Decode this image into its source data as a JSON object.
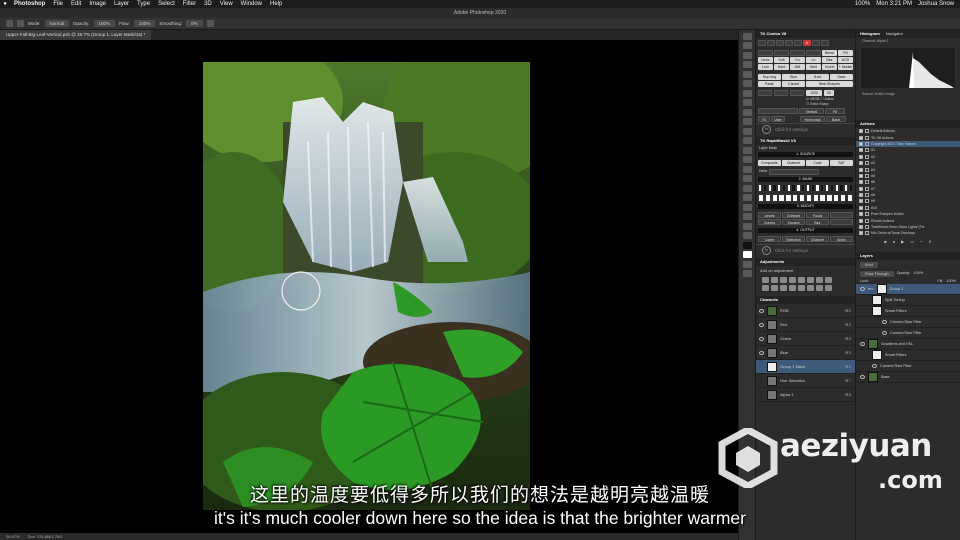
{
  "menubar": {
    "app": "Photoshop",
    "items": [
      "File",
      "Edit",
      "Image",
      "Layer",
      "Type",
      "Select",
      "Filter",
      "3D",
      "View",
      "Window",
      "Help"
    ],
    "battery": "100%",
    "clock": "Mon 3:21 PM",
    "user": "Joshua Snow"
  },
  "app_title": "Adobe Photoshop 2020",
  "options_bar": {
    "mode_label": "Mode:",
    "mode_value": "Normal",
    "opacity_label": "Opacity:",
    "opacity_value": "100%",
    "flow_label": "Flow:",
    "flow_value": "100%",
    "smoothing_label": "Smoothing:",
    "smoothing_value": "0%"
  },
  "document_tab": "Upper-Fall-Big-Leaf-Vertical.psb @ 26.7% (Group 1, Layer Mask/16) *",
  "statusbar": {
    "zoom": "26.67%",
    "doc": "Doc: 374.8M/1.76G"
  },
  "tk_panel": {
    "title": "TK Combo V8",
    "buttons_row1": [
      "Blend",
      "Fill"
    ],
    "buttons_row2": [
      "Norm",
      "Soft",
      "Co",
      "Lu",
      "Blur",
      "ACR"
    ],
    "buttons_row3": [
      "Lum",
      "Hard",
      "Diff",
      "Mult",
      "Invert",
      "+ Sketch"
    ],
    "buttons_row4": [
      "Dup Img",
      "Size",
      "8-bit",
      "Save"
    ],
    "buttons_row5": [
      "Paste",
      "Cancel",
      "Web Sharpen"
    ],
    "size_value": "1200",
    "size_value2": "30",
    "checkbox1": "sRGB",
    "checkbox2": "Action",
    "checkbox3": "Extra Sharp",
    "vertical": "Vertical",
    "fit": "Fit",
    "horizontal": "Horizontal",
    "base": "Base",
    "tk_label": "TK",
    "user_label": "User",
    "fx_hint": "Click for settings"
  },
  "rapidmask": {
    "title": "TK RapidMask2 V8",
    "source_bar": "1. SOURCE",
    "layer_mask": "Layer Mask",
    "composite": "Composite",
    "channel": "Channel",
    "color": "Color",
    "sat": "SAT",
    "delta": "Delta",
    "mask_bar": "2. MASK",
    "modify_bar": "3. MODIFY",
    "levels": "Levels",
    "contract": "Contract",
    "focus": "Focus",
    "curves": "Curves",
    "expand": "Expand",
    "blur": "Blur",
    "output_bar": "4. OUTPUT",
    "layer": "Layer",
    "selection": "Selection",
    "channel_out": "Channel",
    "apply": "Apply",
    "fx_hint": "Click for settings"
  },
  "adjustments": {
    "title": "Adjustments",
    "subtitle": "Add an adjustment"
  },
  "channels": {
    "title": "Channels",
    "rows": [
      {
        "name": "RGB",
        "shortcut": "⌘2"
      },
      {
        "name": "Red",
        "shortcut": "⌘3"
      },
      {
        "name": "Green",
        "shortcut": "⌘4"
      },
      {
        "name": "Blue",
        "shortcut": "⌘5"
      },
      {
        "name": "Group 1 Mask",
        "shortcut": "⌘6"
      },
      {
        "name": "Hue Selection",
        "shortcut": "⌘7"
      },
      {
        "name": "Alpha 1",
        "shortcut": "⌘8"
      }
    ]
  },
  "histogram": {
    "tab1": "Histogram",
    "tab2": "Navigator",
    "channel_label": "Channel:",
    "channel_value": "Alpha 1",
    "source_label": "Source:",
    "source_value": "Entire Image"
  },
  "actions": {
    "title": "Actions",
    "items": [
      "Default Actions",
      "TK V8 Actions",
      "Copyright 2017 Toby Harper",
      "#1",
      "#2",
      "#3",
      "#4",
      "#5",
      "#6",
      "#7",
      "#8",
      "#9",
      "#10",
      "Post Sharpen Action",
      "Rhode Actions",
      "Traditional Orton Glow Lights (Fix",
      "Mix Orton w/Tonal Overlays"
    ]
  },
  "layers": {
    "title": "Layers",
    "kind": "Kind",
    "blend": "Pass Through",
    "opacity_label": "Opacity:",
    "opacity_value": "100%",
    "lock_label": "Lock:",
    "fill_label": "Fill:",
    "fill_value": "100%",
    "rows": [
      {
        "name": "Group 1",
        "level": 0,
        "selected": true,
        "thumb": "mask"
      },
      {
        "name": "Split Toning",
        "level": 1,
        "selected": false,
        "thumb": "white"
      },
      {
        "name": "Smart Filters",
        "level": 2,
        "selected": false,
        "thumb": "white"
      },
      {
        "name": "Camera Raw Filter",
        "level": 2,
        "selected": false,
        "thumb": "none"
      },
      {
        "name": "Camera Raw Filter",
        "level": 2,
        "selected": false,
        "thumb": "none"
      },
      {
        "name": "Gradients and HSL",
        "level": 0,
        "selected": false,
        "thumb": "photo"
      },
      {
        "name": "Smart Filters",
        "level": 1,
        "selected": false,
        "thumb": "white"
      },
      {
        "name": "Camera Raw Filter",
        "level": 1,
        "selected": false,
        "thumb": "none"
      },
      {
        "name": "Base",
        "level": 0,
        "selected": false,
        "thumb": "photo"
      }
    ]
  },
  "subtitles": {
    "zh": "这里的温度要低得多所以我们的想法是越明亮越温暖",
    "en": "it's it's much cooler down here so the idea is that the brighter warmer"
  },
  "watermark": {
    "line1": "aeziyuan",
    "line2": ".com"
  },
  "colors": {
    "selection_blue": "#3f5a78",
    "panel_bg": "#2c2c2c",
    "red_button": "#c93c3c"
  }
}
